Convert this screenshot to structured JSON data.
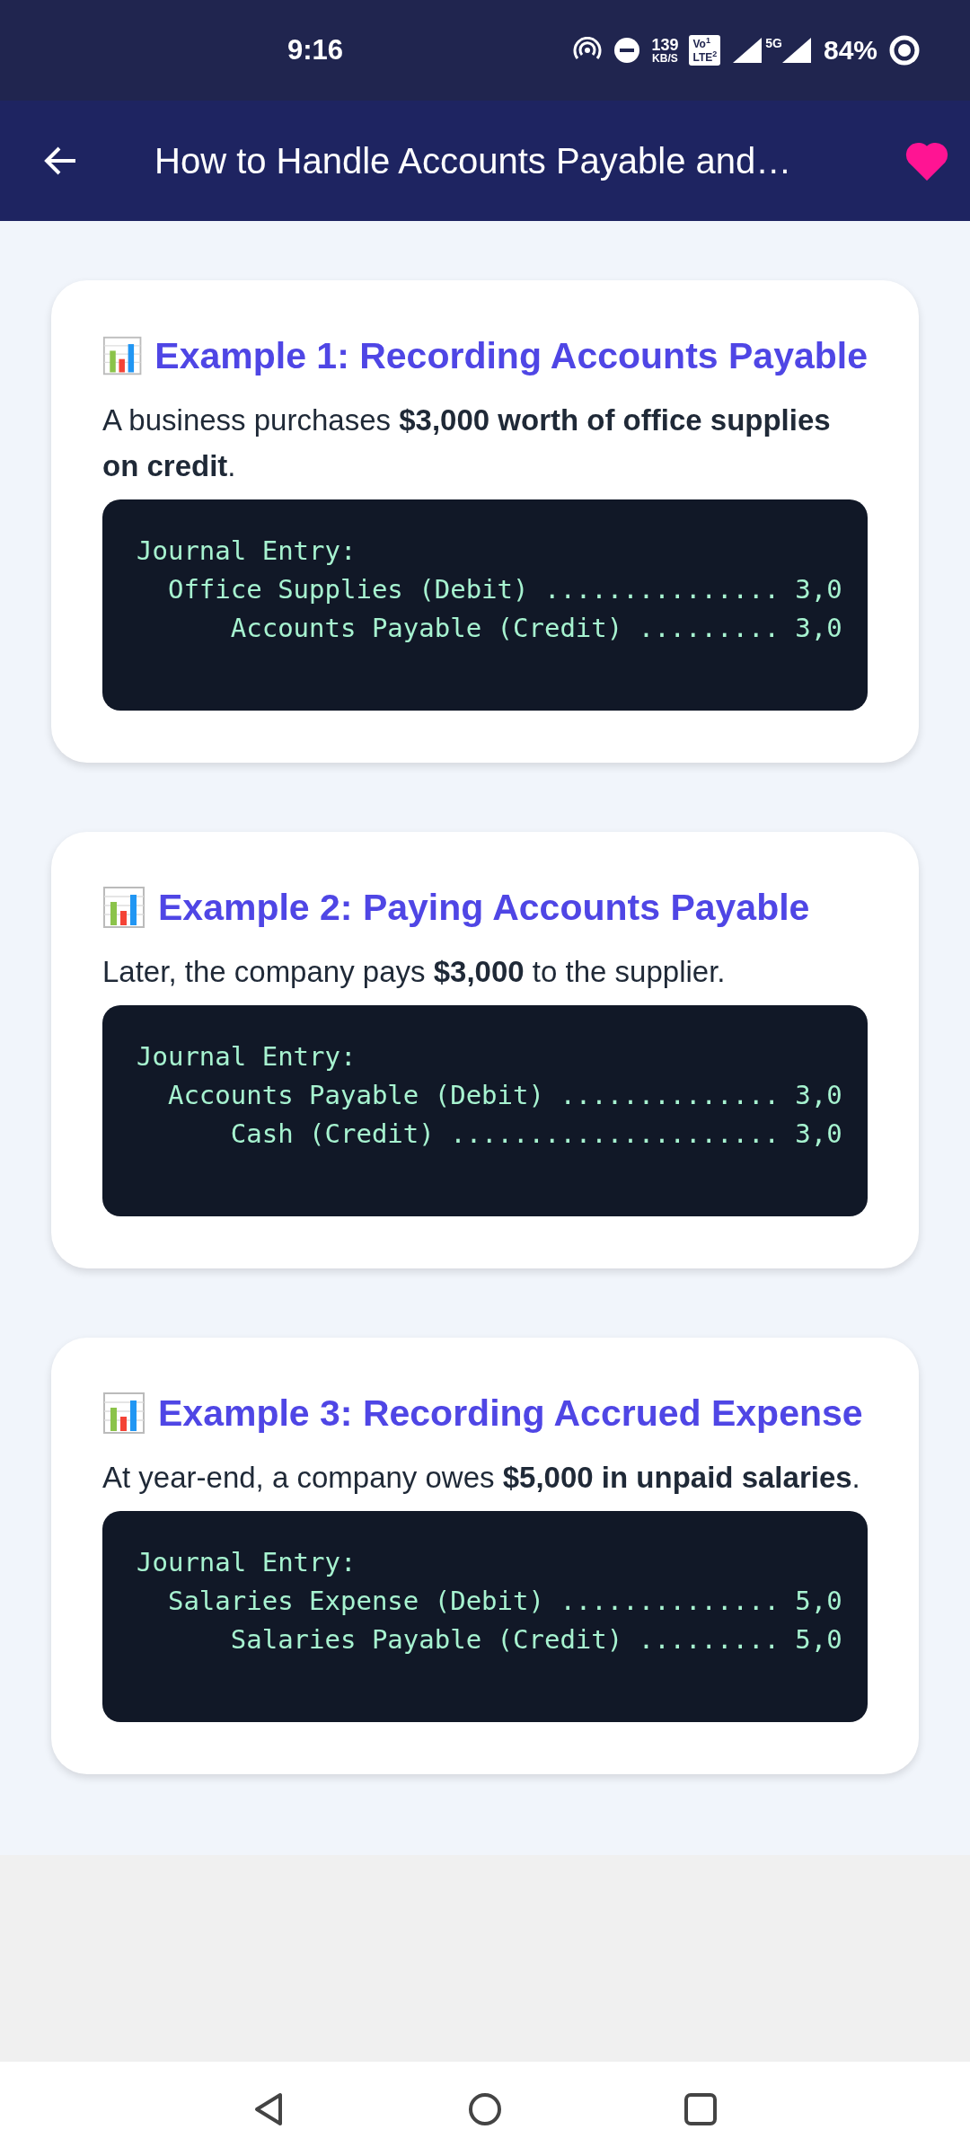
{
  "status_bar": {
    "time": "9:16",
    "net_speed": "139",
    "net_unit": "KB/S",
    "volte_top": "Vo",
    "volte_sim": "1",
    "volte_bottom": "LTE",
    "volte_sim2": "2",
    "network": "5G",
    "battery": "84%"
  },
  "app_bar": {
    "title": "How to Handle Accounts Payable and…",
    "favorite": true
  },
  "examples": [
    {
      "title": "Example 1: Recording Accounts Payable",
      "text": "A business purchases **$3,000 worth of office supplies on credit**.",
      "code": [
        "Journal Entry:",
        "  Office Supplies (Debit) ............... 3,0",
        "      Accounts Payable (Credit) ......... 3,0"
      ]
    },
    {
      "title": "Example 2: Paying Accounts Payable",
      "text": "Later, the company pays **$3,000** to the supplier.",
      "code": [
        "Journal Entry:",
        "  Accounts Payable (Debit) .............. 3,0",
        "      Cash (Credit) ..................... 3,0"
      ]
    },
    {
      "title": "Example 3: Recording Accrued Expense",
      "text": "At year-end, a company owes **$5,000 in unpaid salaries**.",
      "code": [
        "Journal Entry:",
        "  Salaries Expense (Debit) .............. 5,0",
        "      Salaries Payable (Credit) ......... 5,0"
      ]
    }
  ]
}
